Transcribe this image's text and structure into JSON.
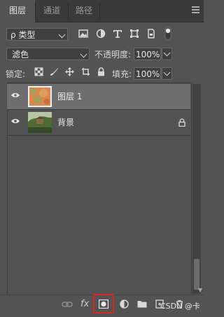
{
  "tabs": [
    {
      "label": "图层",
      "active": true
    },
    {
      "label": "通道",
      "active": false
    },
    {
      "label": "路径",
      "active": false
    }
  ],
  "filter": {
    "kind_label": "ρ 类型",
    "icons": [
      "image-filter-icon",
      "adjustment-filter-icon",
      "type-filter-icon",
      "shape-filter-icon",
      "smart-object-filter-icon",
      "filter-toggle-icon"
    ]
  },
  "blend": {
    "mode": "滤色",
    "opacity_label": "不透明度:",
    "opacity_value": "100%"
  },
  "lock": {
    "label": "锁定:",
    "fill_label": "填充:",
    "fill_value": "100%"
  },
  "layers": [
    {
      "name": "图层 1",
      "selected": true,
      "locked": false
    },
    {
      "name": "背景",
      "selected": false,
      "locked": true
    }
  ],
  "bottom": {
    "fx_label": "fx",
    "watermark": "CSDN @卡"
  },
  "colors": {
    "accent_highlight": "#e0261b",
    "panel_bg": "#535353",
    "selected_row": "#6e6e6e"
  }
}
